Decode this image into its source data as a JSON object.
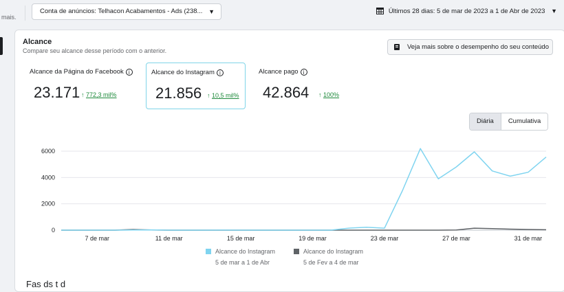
{
  "topbar": {
    "left_fragment": "mais.",
    "account_label": "Conta de anúncios: Telhacon Acabamentos - Ads (238...",
    "date_range": "Últimos 28 dias: 5 de mar de 2023 a 1 de Abr de 2023"
  },
  "card": {
    "title": "Alcance",
    "subtitle": "Compare seu alcance desse período com o anterior.",
    "performance_button": "Veja mais sobre o desempenho do seu conteúdo"
  },
  "metrics": [
    {
      "label": "Alcance da Página do Facebook",
      "value": "23.171",
      "change": "772,3 mil%",
      "arrow": "↑"
    },
    {
      "label": "Alcance do Instagram",
      "value": "21.856",
      "change": "10,5 mil%",
      "arrow": "↑"
    },
    {
      "label": "Alcance pago",
      "value": "42.864",
      "change": "100%",
      "arrow": "↑"
    }
  ],
  "toggle": {
    "daily": "Diária",
    "cumulative": "Cumulativa"
  },
  "chart_data": {
    "type": "line",
    "x": [
      "5 de mar",
      "6 de mar",
      "7 de mar",
      "8 de mar",
      "9 de mar",
      "10 de mar",
      "11 de mar",
      "12 de mar",
      "13 de mar",
      "14 de mar",
      "15 de mar",
      "16 de mar",
      "17 de mar",
      "18 de mar",
      "19 de mar",
      "20 de mar",
      "21 de mar",
      "22 de mar",
      "23 de mar",
      "24 de mar",
      "25 de mar",
      "26 de mar",
      "27 de mar",
      "28 de mar",
      "29 de mar",
      "30 de mar",
      "31 de mar",
      "1 de Abr"
    ],
    "xticks": [
      "7 de mar",
      "11 de mar",
      "15 de mar",
      "19 de mar",
      "23 de mar",
      "27 de mar",
      "31 de mar"
    ],
    "yticks": [
      0,
      2000,
      4000,
      6000
    ],
    "ylim": [
      0,
      6600
    ],
    "series": [
      {
        "name": "Alcance do Instagram",
        "period": "5 de mar a 1 de Abr",
        "color": "#7fd4f0",
        "values": [
          0,
          0,
          0,
          0,
          10,
          20,
          0,
          0,
          0,
          5,
          0,
          0,
          0,
          0,
          0,
          0,
          150,
          220,
          150,
          3000,
          6200,
          3900,
          4800,
          5950,
          4500,
          4100,
          4400,
          5550
        ]
      },
      {
        "name": "Alcance do Instagram",
        "period": "5 de Fev a 4 de mar",
        "color": "#5f6367",
        "values": [
          0,
          0,
          0,
          0,
          50,
          10,
          0,
          0,
          0,
          0,
          0,
          0,
          0,
          0,
          0,
          0,
          0,
          0,
          0,
          0,
          0,
          0,
          10,
          150,
          120,
          80,
          50,
          30
        ]
      }
    ]
  },
  "bottom": {
    "partial_text": "Fas   ds   t     d"
  }
}
